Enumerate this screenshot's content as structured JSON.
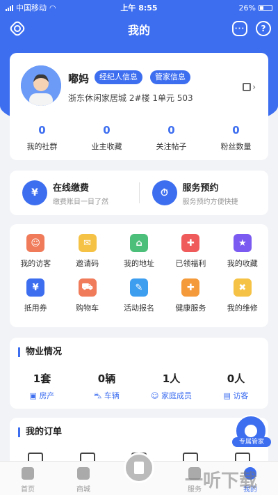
{
  "status_bar": {
    "carrier": "中国移动",
    "time": "上午 8:55",
    "battery": "26%"
  },
  "nav": {
    "title": "我的",
    "settings_icon": "settings-icon",
    "message_icon": "message-icon",
    "help_icon": "help-icon"
  },
  "profile": {
    "name": "嘟妈",
    "tags": [
      "经纪人信息",
      "管家信息"
    ],
    "address": "浙东休闲家居城 2#楼 1单元 503",
    "stats": [
      {
        "value": "0",
        "label": "我的社群"
      },
      {
        "value": "0",
        "label": "业主收藏"
      },
      {
        "value": "0",
        "label": "关注帖子"
      },
      {
        "value": "0",
        "label": "粉丝数量"
      }
    ]
  },
  "services": [
    {
      "title": "在线缴费",
      "subtitle": "缴费账目一目了然",
      "icon": "¥"
    },
    {
      "title": "服务预约",
      "subtitle": "服务预约方便快捷",
      "icon": "⏱"
    }
  ],
  "grid": [
    {
      "label": "我的访客",
      "icon": "visitor-icon",
      "color": "#f07b5a",
      "glyph": "☺"
    },
    {
      "label": "邀请码",
      "icon": "invite-icon",
      "color": "#f5c245",
      "glyph": "✉"
    },
    {
      "label": "我的地址",
      "icon": "address-icon",
      "color": "#4cbf7a",
      "glyph": "⌂"
    },
    {
      "label": "已领福利",
      "icon": "gift-icon",
      "color": "#ef5a5a",
      "glyph": "✚"
    },
    {
      "label": "我的收藏",
      "icon": "favorite-icon",
      "color": "#7a5af0",
      "glyph": "★"
    },
    {
      "label": "抵用券",
      "icon": "coupon-icon",
      "color": "#3d6ef0",
      "glyph": "¥"
    },
    {
      "label": "购物车",
      "icon": "cart-icon",
      "color": "#f07b5a",
      "glyph": "⛟"
    },
    {
      "label": "活动报名",
      "icon": "signup-icon",
      "color": "#3d9ef0",
      "glyph": "✎"
    },
    {
      "label": "健康服务",
      "icon": "health-icon",
      "color": "#f59a3a",
      "glyph": "✚"
    },
    {
      "label": "我的维修",
      "icon": "repair-icon",
      "color": "#f5c245",
      "glyph": "✖"
    }
  ],
  "property": {
    "title": "物业情况",
    "items": [
      {
        "value": "1套",
        "label": "房产"
      },
      {
        "value": "0辆",
        "label": "车辆"
      },
      {
        "value": "1人",
        "label": "家庭成员"
      },
      {
        "value": "0人",
        "label": "访客"
      }
    ]
  },
  "orders": {
    "title": "我的订单"
  },
  "float_button": {
    "label": "专属管家"
  },
  "tabbar": [
    {
      "label": "首页",
      "icon": "home-icon",
      "active": false
    },
    {
      "label": "商城",
      "icon": "mall-icon",
      "active": false
    },
    {
      "label": "",
      "icon": "center-icon",
      "active": false
    },
    {
      "label": "服务",
      "icon": "service-icon",
      "active": false
    },
    {
      "label": "我的",
      "icon": "me-icon",
      "active": true
    }
  ],
  "watermark": "一听下载",
  "colors": {
    "primary": "#3d6ef0",
    "background": "#f2f3f7"
  }
}
